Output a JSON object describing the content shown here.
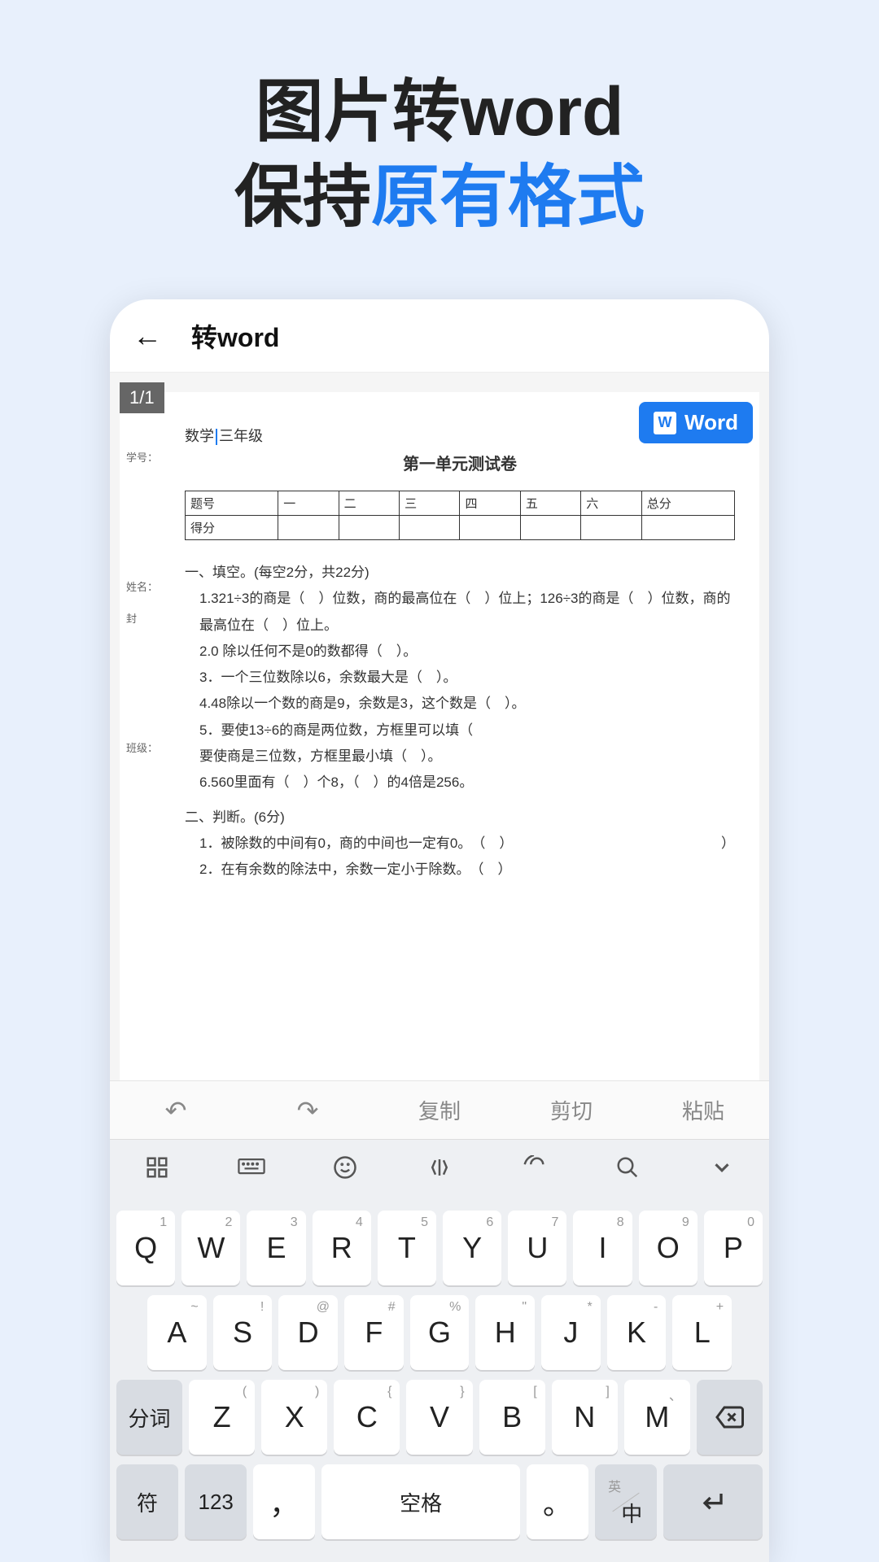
{
  "headline": {
    "line1": "图片转word",
    "line2_a": "保持",
    "line2_b": "原有格式"
  },
  "app": {
    "back_glyph": "←",
    "title": "转word",
    "page_badge": "1/1",
    "word_button": "Word",
    "word_icon_text": "W"
  },
  "document": {
    "sidebar_label_xuehao": "学号：",
    "sidebar_label_xingming": "姓名：",
    "sidebar_label_feng": "封",
    "sidebar_label_banji": "班级：",
    "subject_prefix": "数学",
    "subject_grade": "三年级",
    "title": "第一单元测试卷",
    "table_headers": [
      "题号",
      "一",
      "二",
      "三",
      "四",
      "五",
      "六",
      "总分"
    ],
    "table_row_label": "得分",
    "section1_title": "一、填空。(每空2分，共22分)",
    "q1": "1.321÷3的商是（　）位数，商的最高位在（　）位上；126÷3的商是（　）位数，商的最高位在（　）位上。",
    "q2": "2.0 除以任何不是0的数都得（　）。",
    "q3": "3．一个三位数除以6，余数最大是（　）。",
    "q4": "4.48除以一个数的商是9，余数是3，这个数是（　）。",
    "q5a": "5．要使13÷6的商是两位数，方框里可以填（",
    "q5b": "要使商是三位数，方框里最小填（　）。",
    "q6": "6.560里面有（　）个8，（　）的4倍是256。",
    "section2_title": "二、判断。(6分)",
    "j1": "1．被除数的中间有0，商的中间也一定有0。　（　）",
    "j1r": "）",
    "j2": "2．在有余数的除法中，余数一定小于除数。　（　）"
  },
  "edit_toolbar": {
    "undo": "↶",
    "redo": "↷",
    "copy": "复制",
    "cut": "剪切",
    "paste": "粘贴"
  },
  "kb_toolbar": {
    "grid": "⊞",
    "keyboard": "⌨",
    "emoji": "☺",
    "cursor": "⟨I⟩",
    "voice": "⚙",
    "search": "🔍",
    "collapse": "⌄"
  },
  "keyboard": {
    "row1": [
      {
        "sup": "1",
        "main": "Q"
      },
      {
        "sup": "2",
        "main": "W"
      },
      {
        "sup": "3",
        "main": "E"
      },
      {
        "sup": "4",
        "main": "R"
      },
      {
        "sup": "5",
        "main": "T"
      },
      {
        "sup": "6",
        "main": "Y"
      },
      {
        "sup": "7",
        "main": "U"
      },
      {
        "sup": "8",
        "main": "I"
      },
      {
        "sup": "9",
        "main": "O"
      },
      {
        "sup": "0",
        "main": "P"
      }
    ],
    "row2": [
      {
        "sup": "~",
        "main": "A"
      },
      {
        "sup": "!",
        "main": "S"
      },
      {
        "sup": "@",
        "main": "D"
      },
      {
        "sup": "#",
        "main": "F"
      },
      {
        "sup": "%",
        "main": "G"
      },
      {
        "sup": "\"",
        "main": "H"
      },
      {
        "sup": "*",
        "main": "J"
      },
      {
        "sup": "-",
        "main": "K"
      },
      {
        "sup": "+",
        "main": "L"
      }
    ],
    "row3_left": "分词",
    "row3": [
      {
        "sup": "(",
        "main": "Z"
      },
      {
        "sup": ")",
        "main": "X"
      },
      {
        "sup": "{",
        "main": "C"
      },
      {
        "sup": "}",
        "main": "V"
      },
      {
        "sup": "[",
        "main": "B"
      },
      {
        "sup": "]",
        "main": "N"
      },
      {
        "sup": "、",
        "main": "M"
      }
    ],
    "row3_del": "⌫",
    "row4": {
      "sym": "符",
      "num": "123",
      "comma": "，",
      "space": "空格",
      "period": "。",
      "lang_sup": "英",
      "lang_main": "中",
      "enter": "↵"
    }
  }
}
